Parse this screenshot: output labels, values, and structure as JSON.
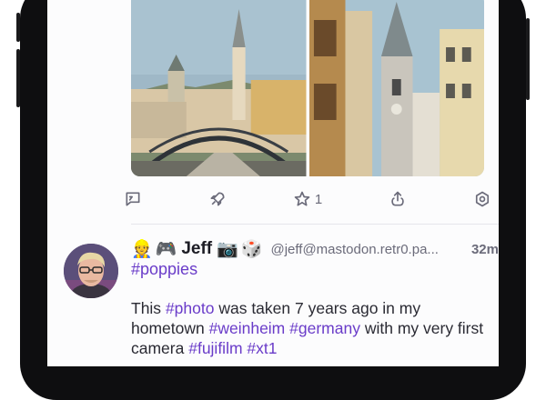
{
  "actions": {
    "reply_label": "",
    "boost_label": "",
    "favourite_count": "1",
    "share_label": "",
    "more_label": ""
  },
  "post": {
    "author_name": "Jeff",
    "author_emoji_prefix": [
      "👷",
      "🎮"
    ],
    "author_emoji_suffix": [
      "📷",
      "🎲"
    ],
    "handle": "@jeff@mastodon.retr0.pa...",
    "time": "32m",
    "header_hashtag": "#poppies",
    "content": {
      "t1": "This ",
      "tag1": "#photo",
      "t2": " was taken 7 years ago in my hometown ",
      "tag2": "#weinheim",
      "t3": " ",
      "tag3": "#germany",
      "t4": " with my very first camera ",
      "tag4": "#fujifilm",
      "t5": " ",
      "tag5": "#xt1"
    }
  },
  "colors": {
    "accent": "#6a3cc9",
    "muted": "#6b6b7a",
    "text": "#2a2a33"
  },
  "icons": [
    "reply-icon",
    "boost-icon",
    "star-icon",
    "share-icon",
    "more-icon"
  ]
}
